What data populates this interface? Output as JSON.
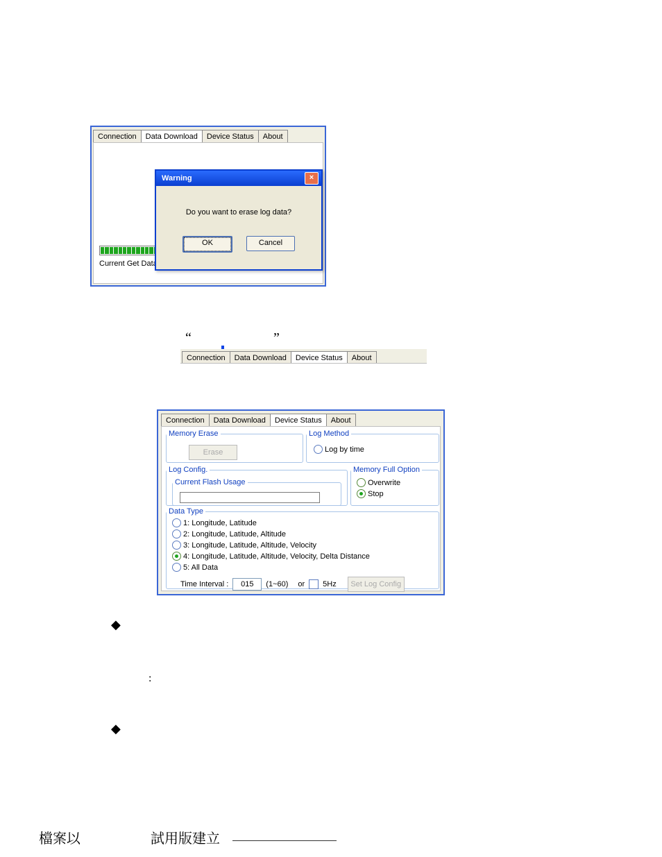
{
  "win1": {
    "tabs": [
      "Connection",
      "Data Download",
      "Device Status",
      "About"
    ],
    "active_tab_index": 1,
    "current_get_label": "Current Get Data:",
    "dialog": {
      "title": "Warning",
      "close_icon": "×",
      "message": "Do you want to erase log data?",
      "ok_label": "OK",
      "cancel_label": "Cancel"
    }
  },
  "midstrip": {
    "tabs": [
      "Connection",
      "Data Download",
      "Device Status",
      "About"
    ],
    "active_tab_index": 2
  },
  "win2": {
    "tabs": [
      "Connection",
      "Data Download",
      "Device Status",
      "About"
    ],
    "active_tab_index": 2,
    "memory_erase": {
      "legend": "Memory Erase",
      "erase_btn": "Erase"
    },
    "log_method": {
      "legend": "Log Method",
      "option1": "Log by time"
    },
    "log_config": {
      "legend": "Log Config."
    },
    "flash_usage": {
      "legend": "Current Flash Usage"
    },
    "mem_full": {
      "legend": "Memory Full Option",
      "overwrite": "Overwrite",
      "stop": "Stop",
      "selected": "stop"
    },
    "data_type": {
      "legend": "Data Type",
      "opts": [
        "1: Longitude, Latitude",
        "2: Longitude, Latitude, Altitude",
        "3: Longitude, Latitude, Altitude, Velocity",
        "4: Longitude, Latitude, Altitude, Velocity, Delta Distance",
        "5: All Data"
      ],
      "selected_index": 3,
      "time_interval_label": "Time Interval :",
      "time_interval_value": "015",
      "range_label": "(1~60)",
      "or_label": "or",
      "checkbox_label": "5Hz",
      "set_btn": "Set Log Config"
    }
  },
  "footer": {
    "left": "檔案以",
    "mid": "試用版建立"
  }
}
